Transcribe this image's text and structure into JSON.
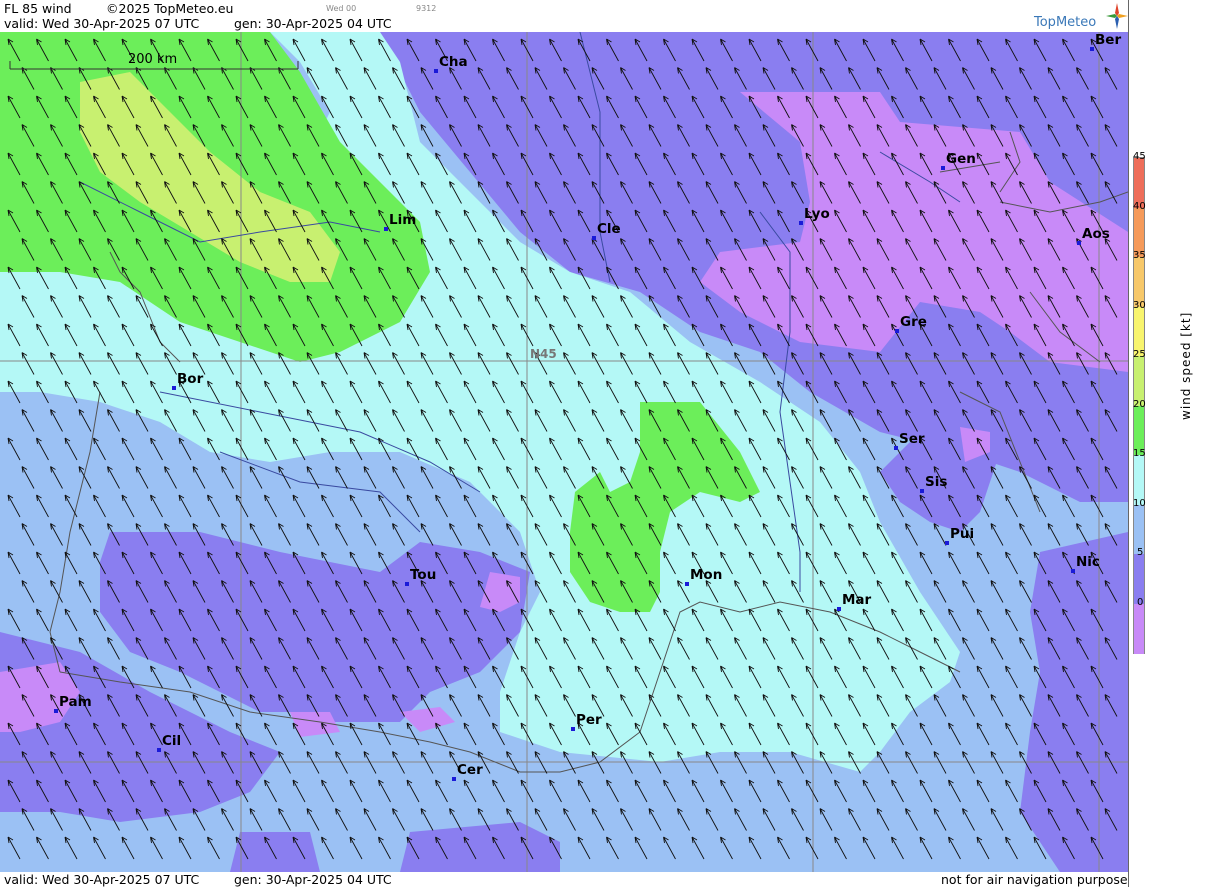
{
  "header": {
    "title": "FL 85 wind",
    "copyright": "©2025 TopMeteo.eu",
    "small_label": "Wed 00",
    "small_code": "9312",
    "valid": "valid:  Wed  30-Apr-2025  07 UTC",
    "gen": "gen: 30-Apr-2025 04 UTC"
  },
  "logo": {
    "text": "TopMeteo",
    "icon": "compass-star-icon"
  },
  "scale_bar": {
    "label": "200 km"
  },
  "grid": {
    "lat_label": "N45"
  },
  "cities": [
    {
      "name": "Cha"
    },
    {
      "name": "Lim"
    },
    {
      "name": "Cle"
    },
    {
      "name": "Lyo"
    },
    {
      "name": "Gen"
    },
    {
      "name": "Ber"
    },
    {
      "name": "Aos"
    },
    {
      "name": "Gre"
    },
    {
      "name": "Bor"
    },
    {
      "name": "Ser"
    },
    {
      "name": "Sis"
    },
    {
      "name": "Pui"
    },
    {
      "name": "Nic"
    },
    {
      "name": "Tou"
    },
    {
      "name": "Mon"
    },
    {
      "name": "Mar"
    },
    {
      "name": "Pam"
    },
    {
      "name": "Cil"
    },
    {
      "name": "Per"
    },
    {
      "name": "Cer"
    }
  ],
  "legend": {
    "title": "wind speed [kt]",
    "ticks": [
      "45",
      "40",
      "35",
      "30",
      "25",
      "20",
      "15",
      "10",
      "5",
      "0"
    ],
    "colors": [
      "#ee6e5a",
      "#f59a5a",
      "#f7c86a",
      "#f8f46e",
      "#c8f070",
      "#6cee5a",
      "#b4f8f6",
      "#9bc1f4",
      "#8a7ef0",
      "#c88af8"
    ]
  },
  "footer": {
    "valid": "valid:  Wed  30-Apr-2025  07 UTC",
    "gen": "gen: 30-Apr-2025 04 UTC",
    "disclaimer": "not for air navigation purposes"
  }
}
